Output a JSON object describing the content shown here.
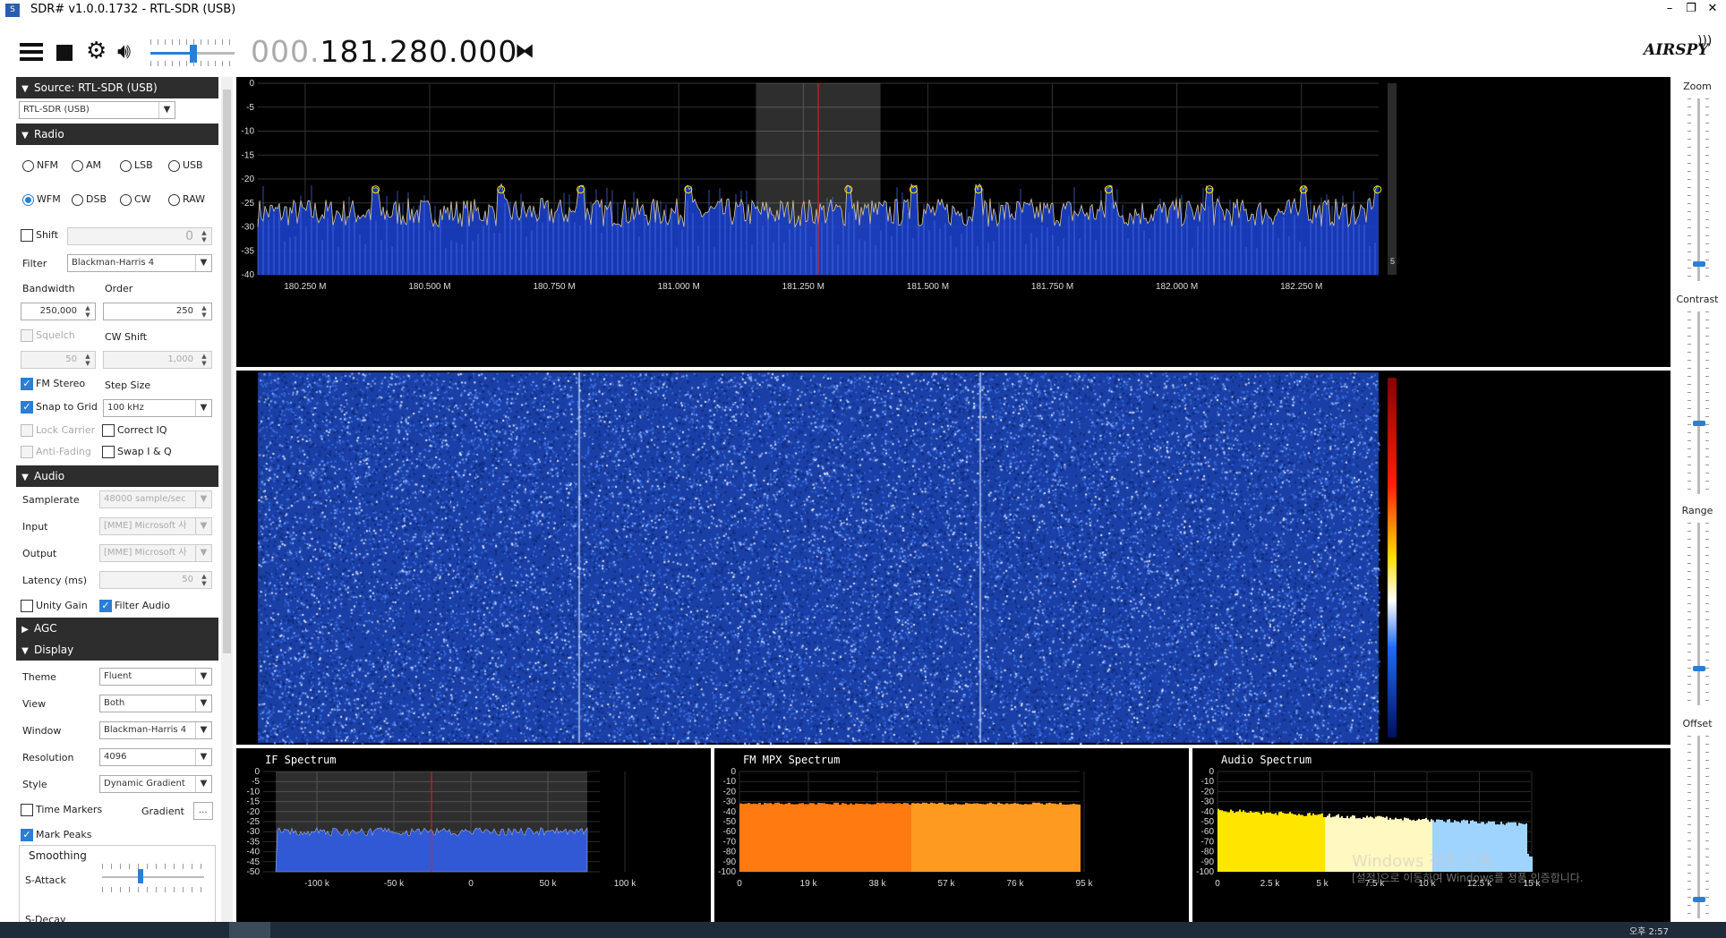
{
  "window": {
    "title": "SDR# v1.0.0.1732 - RTL-SDR (USB)",
    "minimize": "–",
    "restore": "❐",
    "close": "✕"
  },
  "toolbar": {
    "freq_prefix": "000.",
    "freq_main": "181.280.000",
    "logo": "AIRSPY",
    "volume": 0.5
  },
  "source": {
    "header": "Source: RTL-SDR (USB)",
    "device": "RTL-SDR (USB)"
  },
  "radio": {
    "header": "Radio",
    "modes": [
      "NFM",
      "AM",
      "LSB",
      "USB",
      "WFM",
      "DSB",
      "CW",
      "RAW"
    ],
    "selected_mode": "WFM",
    "shift_label": "Shift",
    "shift_value": "0",
    "filter_label": "Filter",
    "filter_value": "Blackman-Harris 4",
    "bandwidth_label": "Bandwidth",
    "order_label": "Order",
    "bandwidth_value": "250,000",
    "order_value": "250",
    "squelch_label": "Squelch",
    "cw_shift_label": "CW Shift",
    "squelch_value": "50",
    "cw_shift_value": "1,000",
    "fm_stereo_label": "FM Stereo",
    "step_size_label": "Step Size",
    "snap_label": "Snap to Grid",
    "step_value": "100 kHz",
    "lock_carrier_label": "Lock Carrier",
    "correct_iq_label": "Correct IQ",
    "anti_fading_label": "Anti-Fading",
    "swap_iq_label": "Swap I & Q"
  },
  "audio": {
    "header": "Audio",
    "samplerate_label": "Samplerate",
    "samplerate_value": "48000 sample/sec",
    "input_label": "Input",
    "input_value": "[MME] Microsoft 사",
    "output_label": "Output",
    "output_value": "[MME] Microsoft 사",
    "latency_label": "Latency (ms)",
    "latency_value": "50",
    "unity_gain_label": "Unity Gain",
    "filter_audio_label": "Filter Audio"
  },
  "agc": {
    "header": "AGC"
  },
  "display": {
    "header": "Display",
    "theme_label": "Theme",
    "theme_value": "Fluent",
    "view_label": "View",
    "view_value": "Both",
    "window_label": "Window",
    "window_value": "Blackman-Harris 4",
    "resolution_label": "Resolution",
    "resolution_value": "4096",
    "style_label": "Style",
    "style_value": "Dynamic Gradient",
    "time_markers_label": "Time Markers",
    "gradient_label": "Gradient",
    "gradient_btn": "...",
    "mark_peaks_label": "Mark Peaks",
    "smoothing_label": "Smoothing",
    "s_attack_label": "S-Attack",
    "s_decay_label": "S-Decay"
  },
  "spectrum": {
    "y_ticks": [
      "0",
      "-5",
      "-10",
      "-15",
      "-20",
      "-25",
      "-30",
      "-35",
      "-40"
    ],
    "x_ticks": [
      "180.250 M",
      "180.500 M",
      "180.750 M",
      "181.000 M",
      "181.250 M",
      "181.500 M",
      "181.750 M",
      "182.000 M",
      "182.250 M"
    ],
    "level_box": "5",
    "center_freq_mhz": 181.28,
    "filter_start_mhz": 181.155,
    "filter_end_mhz": 181.405
  },
  "if_spectrum": {
    "title": "IF Spectrum",
    "y_ticks": [
      "0",
      "-5",
      "-10",
      "-15",
      "-20",
      "-25",
      "-30",
      "-35",
      "-40",
      "-45",
      "-50"
    ],
    "x_ticks": [
      "-100 k",
      "-50 k",
      "0",
      "50 k",
      "100 k"
    ]
  },
  "mpx_spectrum": {
    "title": "FM MPX Spectrum",
    "y_ticks": [
      "0",
      "-10",
      "-20",
      "-30",
      "-40",
      "-50",
      "-60",
      "-70",
      "-80",
      "-90",
      "-100"
    ],
    "x_ticks": [
      "0",
      "19 k",
      "38 k",
      "57 k",
      "76 k",
      "95 k"
    ]
  },
  "audio_spectrum": {
    "title": "Audio Spectrum",
    "y_ticks": [
      "0",
      "-10",
      "-20",
      "-30",
      "-40",
      "-50",
      "-60",
      "-70",
      "-80",
      "-90",
      "-100"
    ],
    "x_ticks": [
      "0",
      "2.5 k",
      "5 k",
      "7.5 k",
      "10 k",
      "12.5 k",
      "15 k"
    ]
  },
  "right_panel": {
    "zoom_label": "Zoom",
    "contrast_label": "Contrast",
    "range_label": "Range",
    "offset_label": "Offset"
  },
  "watermark": {
    "line1": "Windows 정품 인증",
    "line2": "[설정]으로 이동하여 Windows를 정품 인증합니다."
  },
  "taskbar": {
    "clock": "오후 2:57"
  },
  "colors": {
    "accent": "#2a7fd4",
    "header_bg": "#2d2d2d",
    "spectrum_fill": "#1f3fd0",
    "mpx_fill": "#ff8c1a",
    "audio_fill": "#ffe600"
  }
}
